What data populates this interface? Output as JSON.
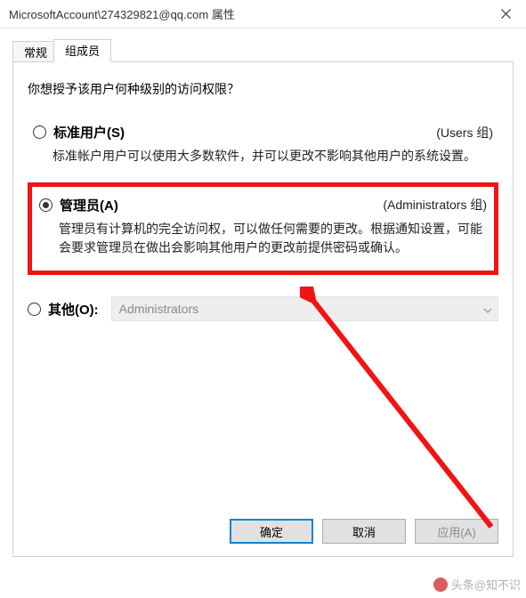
{
  "titlebar": {
    "title": "MicrosoftAccount\\274329821@qq.com 属性"
  },
  "tabs": {
    "general": "常规",
    "membership": "组成员"
  },
  "prompt": "你想授予该用户何种级别的访问权限？",
  "options": {
    "standard": {
      "label": "标准用户(S)",
      "group": "(Users 组)",
      "desc": "标准帐户用户可以使用大多数软件，并可以更改不影响其他用户的系统设置。"
    },
    "admin": {
      "label": "管理员(A)",
      "group": "(Administrators 组)",
      "desc": "管理员有计算机的完全访问权，可以做任何需要的更改。根据通知设置，可能会要求管理员在做出会影响其他用户的更改前提供密码或确认。"
    },
    "other": {
      "label": "其他(O):",
      "combo_value": "Administrators"
    }
  },
  "buttons": {
    "ok": "确定",
    "cancel": "取消",
    "apply": "应用(A)"
  },
  "watermark": "头条@知不识"
}
